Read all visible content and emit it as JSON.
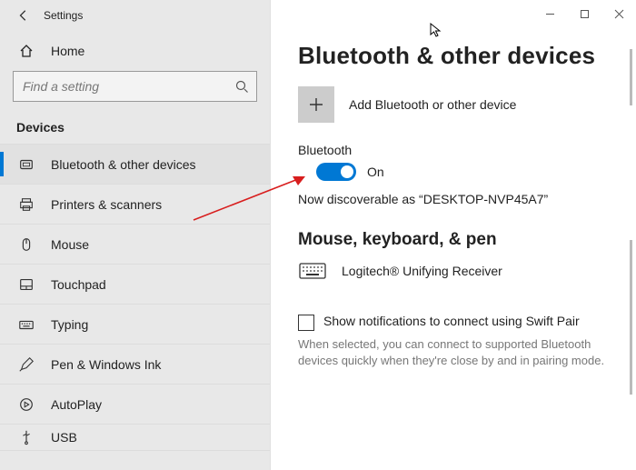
{
  "window": {
    "title": "Settings"
  },
  "sidebar": {
    "home_label": "Home",
    "search_placeholder": "Find a setting",
    "section_title": "Devices",
    "items": [
      {
        "label": "Bluetooth & other devices",
        "icon": "bluetooth-icon",
        "active": true
      },
      {
        "label": "Printers & scanners",
        "icon": "printer-icon",
        "active": false
      },
      {
        "label": "Mouse",
        "icon": "mouse-icon",
        "active": false
      },
      {
        "label": "Touchpad",
        "icon": "touchpad-icon",
        "active": false
      },
      {
        "label": "Typing",
        "icon": "typing-icon",
        "active": false
      },
      {
        "label": "Pen & Windows Ink",
        "icon": "pen-icon",
        "active": false
      },
      {
        "label": "AutoPlay",
        "icon": "autoplay-icon",
        "active": false
      },
      {
        "label": "USB",
        "icon": "usb-icon",
        "active": false
      }
    ]
  },
  "content": {
    "page_title": "Bluetooth & other devices",
    "add_label": "Add Bluetooth or other device",
    "bluetooth_label": "Bluetooth",
    "toggle_state": "On",
    "discover_text": "Now discoverable as “DESKTOP-NVP45A7”",
    "group_title": "Mouse, keyboard, & pen",
    "devices": [
      {
        "name": "Logitech® Unifying Receiver",
        "icon": "keyboard-icon"
      }
    ],
    "swift_pair_label": "Show notifications to connect using Swift Pair",
    "swift_pair_desc": "When selected, you can connect to supported Bluetooth devices quickly when they're close by and in pairing mode."
  },
  "colors": {
    "accent": "#0078d4",
    "sidebar_bg": "#e8e8e8"
  }
}
